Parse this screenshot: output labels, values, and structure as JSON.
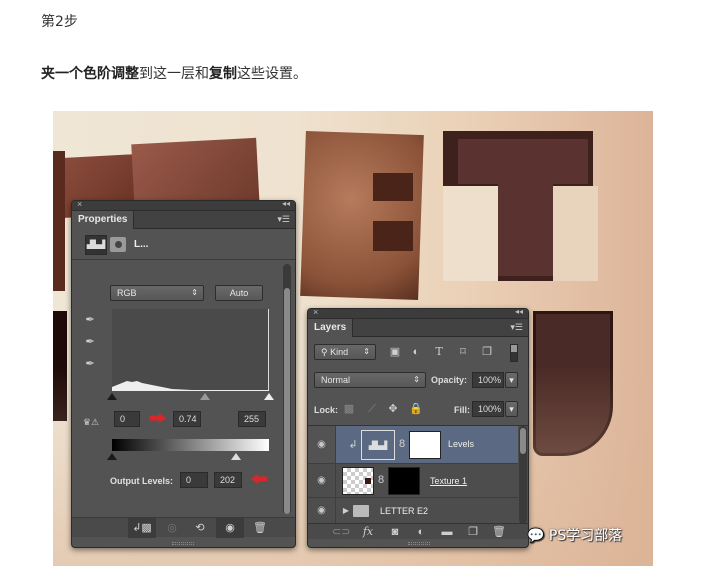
{
  "article": {
    "step_title": "第2步",
    "description": {
      "part1_bold": "夹一个色阶调整",
      "part2": "到这一层和",
      "part3_bold": "复制",
      "part4": "这些设置。"
    }
  },
  "properties_panel": {
    "tab_label": "Properties",
    "close_icon": "×",
    "collapse_icon": "◂◂",
    "menu_icon": "▾☰",
    "adjustment_name": "L...",
    "channel_select": "RGB",
    "auto_button": "Auto",
    "input_levels": {
      "black": "0",
      "gamma": "0.74",
      "white": "255"
    },
    "output_levels_label": "Output Levels:",
    "output_levels": {
      "black": "0",
      "white": "202"
    },
    "input_slider_positions": {
      "black": 0,
      "gamma": 0.74,
      "white": 255
    },
    "output_slider_positions": {
      "black": 0,
      "white": 202
    }
  },
  "layers_panel": {
    "tab_label": "Layers",
    "close_icon": "×",
    "collapse_icon": "◂◂",
    "menu_icon": "▾☰",
    "filter_select": "Kind",
    "blend_mode": "Normal",
    "opacity_label": "Opacity:",
    "opacity_value": "100%",
    "lock_label": "Lock:",
    "fill_label": "Fill:",
    "fill_value": "100%",
    "layers": [
      {
        "name": "Levels",
        "selected": true,
        "type": "adjustment",
        "clipped": true
      },
      {
        "name": "Texture 1",
        "selected": false,
        "type": "image-with-mask"
      },
      {
        "name": "LETTER E2",
        "selected": false,
        "type": "group"
      }
    ]
  },
  "watermark": {
    "text": "PS学习部落"
  },
  "colors": {
    "panel_bg": "#535353",
    "selected_layer": "#5b6a82",
    "red_arrow": "#d8262a"
  }
}
